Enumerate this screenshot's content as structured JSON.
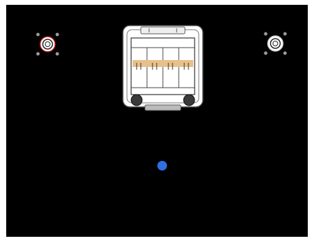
{
  "scene": {
    "background_color": "#000000",
    "frame_color": "#ffffff",
    "components": [
      {
        "name": "grommet-left",
        "icon": "cable-gland-icon",
        "ring_color": "#b01010"
      },
      {
        "name": "grommet-right",
        "icon": "cable-gland-icon",
        "ring_color": "#ffffff"
      },
      {
        "name": "breaker-enclosure",
        "icon": "circuit-breaker-box-icon",
        "breaker_count": 4,
        "label_strip_color": "#e8c08a"
      },
      {
        "name": "indicator-dot",
        "icon": "blue-dot-icon",
        "color": "#2f6fe0"
      }
    ]
  }
}
